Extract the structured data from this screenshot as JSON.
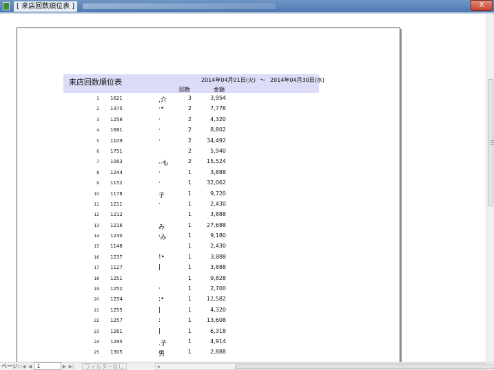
{
  "window": {
    "title": "[ 来店回数順位表 ]",
    "close_label": "X"
  },
  "report": {
    "title": "来店回数順位表",
    "date_from": "2014年04月01日(火)",
    "tilde": "～",
    "date_to": "2014年04月30日(水)",
    "col_count": "回数",
    "col_amount": "金額"
  },
  "rows": [
    {
      "rank": "1",
      "code": "1621",
      "name": ",介",
      "count": "3",
      "amount": "3,954"
    },
    {
      "rank": "2",
      "code": "1375",
      "name": "·•",
      "count": "2",
      "amount": "7,776"
    },
    {
      "rank": "3",
      "code": "1258",
      "name": "·",
      "count": "2",
      "amount": "4,320"
    },
    {
      "rank": "4",
      "code": "1681",
      "name": "·",
      "count": "2",
      "amount": "8,802"
    },
    {
      "rank": "5",
      "code": "1109",
      "name": "·",
      "count": "2",
      "amount": "34,492"
    },
    {
      "rank": "6",
      "code": "1751",
      "name": "",
      "count": "2",
      "amount": "5,940"
    },
    {
      "rank": "7",
      "code": "1083",
      "name": "··も",
      "count": "2",
      "amount": "15,524"
    },
    {
      "rank": "8",
      "code": "1244",
      "name": "·",
      "count": "1",
      "amount": "3,888"
    },
    {
      "rank": "9",
      "code": "1152",
      "name": "·",
      "count": "1",
      "amount": "32,062"
    },
    {
      "rank": "10",
      "code": "1178",
      "name": "子",
      "count": "1",
      "amount": "9,720"
    },
    {
      "rank": "11",
      "code": "1211",
      "name": "·",
      "count": "1",
      "amount": "2,430"
    },
    {
      "rank": "12",
      "code": "1212",
      "name": "",
      "count": "1",
      "amount": "3,888"
    },
    {
      "rank": "13",
      "code": "1216",
      "name": "み",
      "count": "1",
      "amount": "27,688"
    },
    {
      "rank": "14",
      "code": "1230",
      "name": "'み",
      "count": "1",
      "amount": "9,180"
    },
    {
      "rank": "15",
      "code": "1148",
      "name": "",
      "count": "1",
      "amount": "2,430"
    },
    {
      "rank": "16",
      "code": "1237",
      "name": "!•",
      "count": "1",
      "amount": "3,888"
    },
    {
      "rank": "17",
      "code": "1127",
      "name": "|",
      "count": "1",
      "amount": "3,888"
    },
    {
      "rank": "18",
      "code": "1251",
      "name": "",
      "count": "1",
      "amount": "9,828"
    },
    {
      "rank": "19",
      "code": "1252",
      "name": "·",
      "count": "1",
      "amount": "2,700"
    },
    {
      "rank": "20",
      "code": "1254",
      "name": ";•",
      "count": "1",
      "amount": "12,582"
    },
    {
      "rank": "21",
      "code": "1255",
      "name": "|",
      "count": "1",
      "amount": "4,320"
    },
    {
      "rank": "22",
      "code": "1257",
      "name": ":",
      "count": "1",
      "amount": "13,608"
    },
    {
      "rank": "23",
      "code": "1261",
      "name": "|",
      "count": "1",
      "amount": "6,318"
    },
    {
      "rank": "24",
      "code": "1295",
      "name": ".子",
      "count": "1",
      "amount": "4,914"
    },
    {
      "rank": "25",
      "code": "1305",
      "name": "男",
      "count": "1",
      "amount": "2,888"
    }
  ],
  "statusbar": {
    "page_label": "ページ:",
    "first": "|◀",
    "prev": "◀",
    "page_value": "1",
    "next": "▶",
    "last": "▶|",
    "filter_label": "フィルターなし"
  }
}
